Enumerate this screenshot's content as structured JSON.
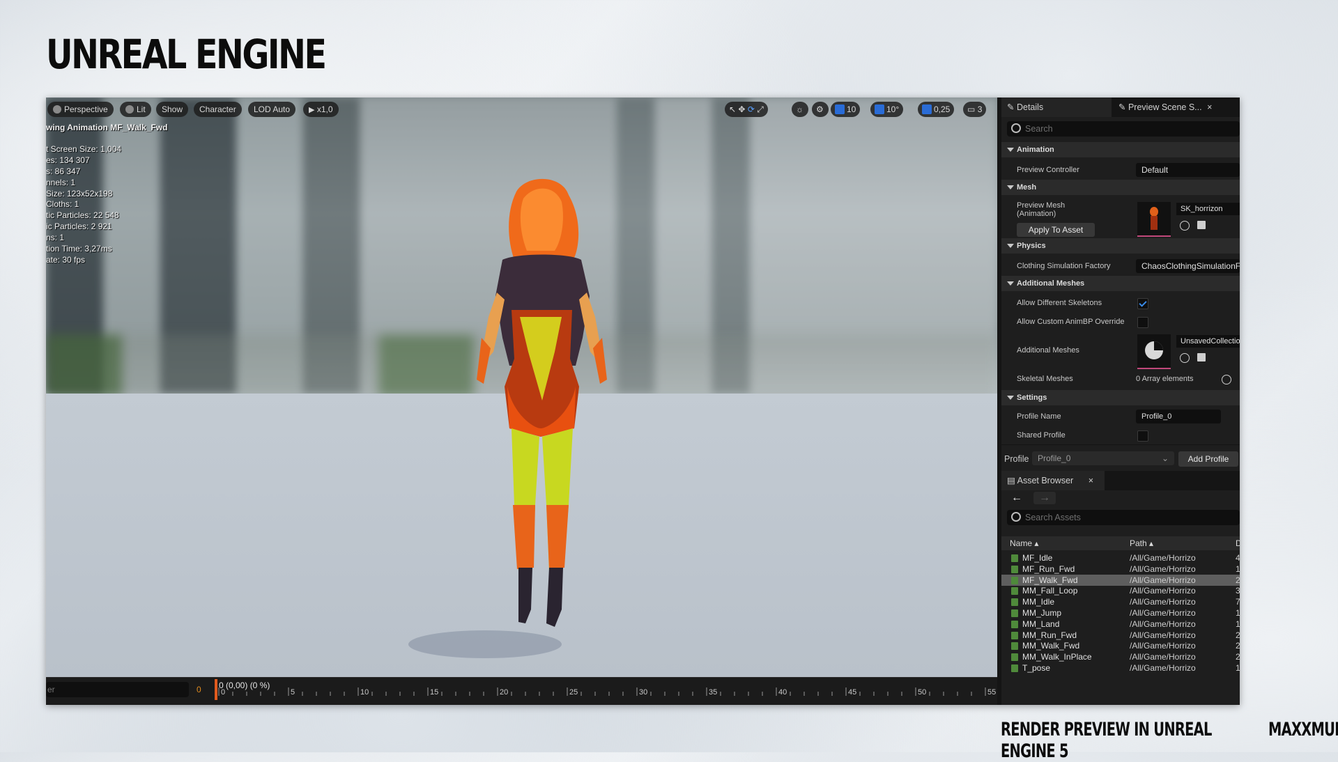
{
  "slide": {
    "title": "UNREAL ENGINE",
    "caption": "RENDER PREVIEW IN UNREAL ENGINE 5",
    "brand": "MAXXMUR"
  },
  "viewport": {
    "toolbar": {
      "perspective": "Perspective",
      "lit": "Lit",
      "show": "Show",
      "character": "Character",
      "lod": "LOD Auto",
      "speed": "x1,0",
      "grid": "10",
      "angle": "10°",
      "scale": "0,25",
      "camera": "3"
    },
    "stats": {
      "header": "wing Animation MF_Walk_Fwd",
      "lines": [
        "t Screen Size: 1,004",
        "es: 134 307",
        "s: 86 347",
        "nnels: 1",
        "Size: 123x52x198",
        "Cloths: 1",
        "tic Particles: 22 548",
        "ic Particles: 2 921",
        "ns: 1",
        "tion Time: 3,27ms",
        "ate: 30 fps"
      ]
    }
  },
  "timeline": {
    "search_placeholder": "er",
    "start_frame": "0",
    "readout": "0 (0,00) (0 %)",
    "ticks": [
      "0",
      "5",
      "10",
      "15",
      "20",
      "25",
      "30",
      "35",
      "40",
      "45",
      "50",
      "55"
    ]
  },
  "details": {
    "tab_details": "Details",
    "tab_preview": "Preview Scene S...",
    "search_placeholder": "Search",
    "animation": {
      "header": "Animation",
      "preview_controller_label": "Preview Controller",
      "preview_controller_value": "Default"
    },
    "mesh": {
      "header": "Mesh",
      "preview_mesh_label": "Preview Mesh (Animation)",
      "apply_button": "Apply To Asset",
      "asset_name": "SK_horrizon"
    },
    "physics": {
      "header": "Physics",
      "clothing_label": "Clothing Simulation Factory",
      "clothing_value": "ChaosClothingSimulationFactory"
    },
    "additional_meshes": {
      "header": "Additional Meshes",
      "allow_diff_skeletons_label": "Allow Different Skeletons",
      "allow_diff_skeletons": true,
      "allow_custom_animbp_label": "Allow Custom AnimBP Override",
      "allow_custom_animbp": false,
      "additional_meshes_label": "Additional Meshes",
      "additional_meshes_value": "UnsavedCollection",
      "skeletal_meshes_label": "Skeletal Meshes",
      "skeletal_meshes_value": "0 Array elements"
    },
    "settings": {
      "header": "Settings",
      "profile_name_label": "Profile Name",
      "profile_name_value": "Profile_0",
      "shared_profile_label": "Shared Profile",
      "shared_profile": false
    },
    "profile_bar": {
      "label": "Profile",
      "selected": "Profile_0",
      "add_button": "Add Profile"
    }
  },
  "asset_browser": {
    "tab": "Asset Browser",
    "search_placeholder": "Search Assets",
    "columns": {
      "name": "Name",
      "path": "Path",
      "extra": "D"
    },
    "rows": [
      {
        "name": "MF_Idle",
        "path": "/All/Game/Horrizo",
        "extra": "4",
        "selected": false
      },
      {
        "name": "MF_Run_Fwd",
        "path": "/All/Game/Horrizo",
        "extra": "1",
        "selected": false
      },
      {
        "name": "MF_Walk_Fwd",
        "path": "/All/Game/Horrizo",
        "extra": "2",
        "selected": true
      },
      {
        "name": "MM_Fall_Loop",
        "path": "/All/Game/Horrizo",
        "extra": "3",
        "selected": false
      },
      {
        "name": "MM_Idle",
        "path": "/All/Game/Horrizo",
        "extra": "7",
        "selected": false
      },
      {
        "name": "MM_Jump",
        "path": "/All/Game/Horrizo",
        "extra": "1",
        "selected": false
      },
      {
        "name": "MM_Land",
        "path": "/All/Game/Horrizo",
        "extra": "1",
        "selected": false
      },
      {
        "name": "MM_Run_Fwd",
        "path": "/All/Game/Horrizo",
        "extra": "2",
        "selected": false
      },
      {
        "name": "MM_Walk_Fwd",
        "path": "/All/Game/Horrizo",
        "extra": "2",
        "selected": false
      },
      {
        "name": "MM_Walk_InPlace",
        "path": "/All/Game/Horrizo",
        "extra": "2",
        "selected": false
      },
      {
        "name": "T_pose",
        "path": "/All/Game/Horrizo",
        "extra": "1",
        "selected": false
      }
    ]
  },
  "colors": {
    "accent": "#2a6cd6",
    "checkbox": "#3a8be8",
    "playhead": "#e05a1e",
    "asset_icon": "#4f8a3b"
  }
}
